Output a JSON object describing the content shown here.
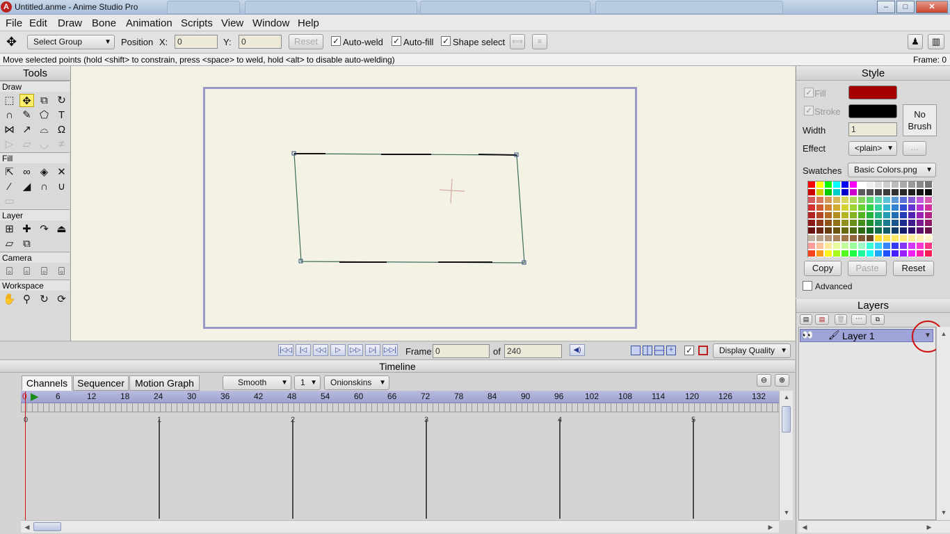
{
  "window": {
    "title": "Untitled.anme - Anime Studio Pro",
    "bg_tabs": [
      "",
      "",
      "",
      ""
    ],
    "controls": {
      "minimize": "–",
      "maximize": "□",
      "close": "✕"
    }
  },
  "menu": [
    "File",
    "Edit",
    "Draw",
    "Bone",
    "Animation",
    "Scripts",
    "View",
    "Window",
    "Help"
  ],
  "toolbar": {
    "group_select": "Select Group",
    "position_label": "Position",
    "x_label": "X:",
    "x_value": "0",
    "y_label": "Y:",
    "y_value": "0",
    "reset": "Reset",
    "auto_weld": "Auto-weld",
    "auto_weld_checked": true,
    "auto_fill": "Auto-fill",
    "auto_fill_checked": true,
    "shape_select": "Shape select",
    "shape_select_checked": true
  },
  "status": {
    "message": "Move selected points (hold <shift> to constrain, press <space> to weld, hold <alt> to disable auto-welding)",
    "frame": "Frame: 0"
  },
  "tools": {
    "title": "Tools",
    "draw": "Draw",
    "fill": "Fill",
    "layer": "Layer",
    "camera": "Camera",
    "workspace": "Workspace",
    "draw_icons": [
      "select-points-icon",
      "transform-points-icon",
      "scale-points-icon",
      "rotate-points-icon",
      "add-point-icon",
      "freehand-icon",
      "draw-shape-icon",
      "text-icon",
      "curvature-icon",
      "magnet-icon",
      "perspective-icon",
      "bend-icon",
      "noise-icon",
      "shear-icon",
      "tilt-icon",
      "delete-edge-icon"
    ],
    "fill_icons": [
      "select-shape-icon",
      "create-shape-icon",
      "paint-bucket-icon",
      "delete-shape-icon",
      "eyedropper-icon",
      "line-width-icon",
      "hide-edge-icon",
      "stroke-exposure-icon",
      "blank-icon"
    ],
    "layer_icons": [
      "translate-layer-icon",
      "scale-layer-icon",
      "rotate-layer-icon",
      "set-origin-icon",
      "flip-layer-icon",
      "switch-layer-icon"
    ],
    "camera_icons": [
      "track-camera-icon",
      "zoom-camera-icon",
      "roll-camera-icon",
      "pan-tilt-camera-icon"
    ],
    "workspace_icons": [
      "hand-icon",
      "zoom-workspace-icon",
      "rotate-workspace-icon",
      "orbit-workspace-icon"
    ]
  },
  "playback": {
    "frame_label": "Frame",
    "frame_value": "0",
    "of_label": "of",
    "total": "240",
    "display_quality": "Display Quality"
  },
  "timeline": {
    "title": "Timeline",
    "tabs": [
      "Channels",
      "Sequencer",
      "Motion Graph"
    ],
    "interp": "Smooth",
    "interp_n": "1",
    "onionskins": "Onionskins",
    "ruler": [
      "0",
      "6",
      "12",
      "18",
      "24",
      "30",
      "36",
      "42",
      "48",
      "54",
      "60",
      "66",
      "72",
      "78",
      "84",
      "90",
      "96",
      "102",
      "108",
      "114",
      "120",
      "126",
      "132"
    ],
    "seconds": [
      "0",
      "1",
      "2",
      "3",
      "4",
      "5"
    ]
  },
  "style": {
    "title": "Style",
    "fill_label": "Fill",
    "fill_color": "#a40000",
    "stroke_label": "Stroke",
    "stroke_color": "#000000",
    "width_label": "Width",
    "width_value": "1",
    "effect_label": "Effect",
    "effect_value": "<plain>",
    "effect_more": "...",
    "brush_line1": "No",
    "brush_line2": "Brush",
    "swatches_label": "Swatches",
    "swatches_value": "Basic Colors.png",
    "copy": "Copy",
    "paste": "Paste",
    "reset": "Reset",
    "advanced": "Advanced"
  },
  "layers": {
    "title": "Layers",
    "items": [
      {
        "name": "Layer 1"
      }
    ]
  }
}
